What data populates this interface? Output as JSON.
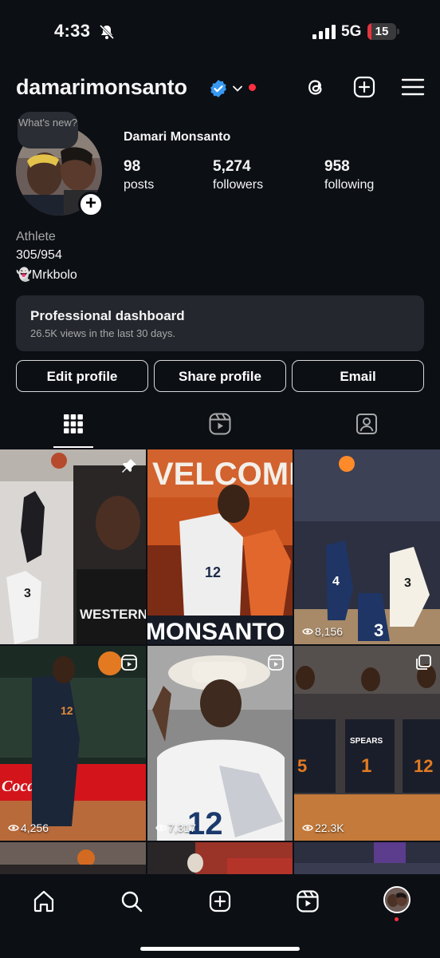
{
  "status_bar": {
    "time": "4:33",
    "network": "5G",
    "battery": "15",
    "battery_level": 0.15
  },
  "header": {
    "username": "damarimonsanto",
    "icons": [
      "threads-icon",
      "create-icon",
      "menu-icon"
    ]
  },
  "profile": {
    "note": "What's new?",
    "full_name": "Damari Monsanto",
    "stats": [
      {
        "num": "98",
        "label": "posts"
      },
      {
        "num": "5,274",
        "label": "followers"
      },
      {
        "num": "958",
        "label": "following"
      }
    ],
    "bio": {
      "category": "Athlete",
      "line1": "305/954",
      "line2": "👻Mrkbolo"
    }
  },
  "dashboard": {
    "title": "Professional dashboard",
    "subtitle": "26.5K views in the last 30 days."
  },
  "buttons": {
    "edit": "Edit profile",
    "share": "Share profile",
    "email": "Email"
  },
  "tabs": [
    "grid-icon",
    "reels-icon",
    "tagged-icon"
  ],
  "grid": {
    "tiles": [
      {
        "views": "",
        "badge": "pin",
        "text": "WESTERN"
      },
      {
        "views": "",
        "badge": "reel",
        "text": "MONSANTO"
      },
      {
        "views": "8,156",
        "badge": "reel",
        "text": ""
      },
      {
        "views": "4,256",
        "badge": "reel",
        "text": "Coca-Cola"
      },
      {
        "views": "7,317",
        "badge": "reel",
        "text": ""
      },
      {
        "views": "22.3K",
        "badge": "carousel",
        "text": "SPEARS"
      }
    ]
  },
  "bottom_nav": [
    "home-icon",
    "search-icon",
    "create-icon",
    "reels-icon",
    "profile-avatar"
  ],
  "colors": {
    "background": "#0c0f14",
    "verified": "#3897f0",
    "notification": "#ff3040",
    "card": "#24272d"
  }
}
